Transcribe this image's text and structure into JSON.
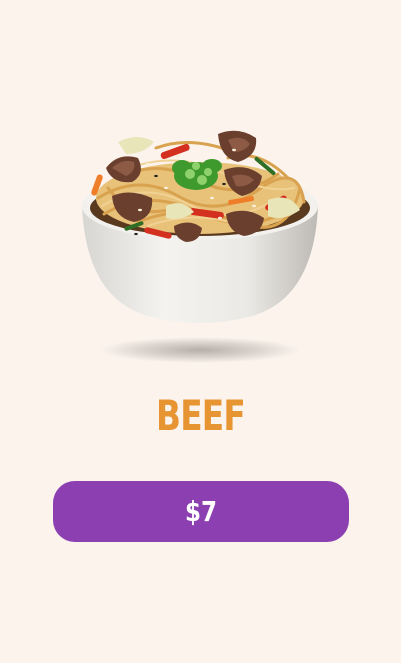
{
  "product": {
    "name": "BEEF",
    "image_icon": "beef-noodle-bowl-image",
    "price_label": "$7"
  },
  "colors": {
    "background": "#fbf3ec",
    "name": "#e79433",
    "button": "#8b3fb1",
    "button_text": "#ffffff"
  }
}
